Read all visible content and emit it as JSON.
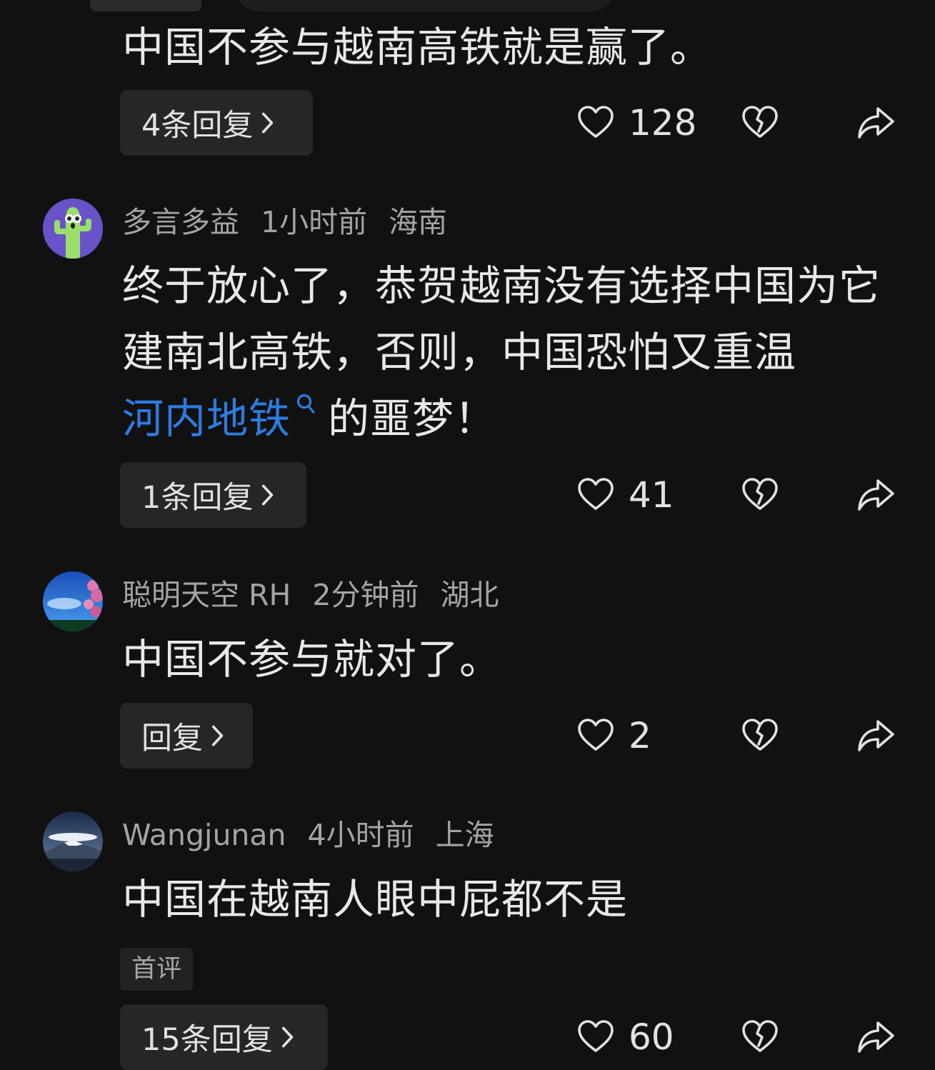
{
  "partial_top": {
    "text": "中国不参与越南高铁就是赢了。",
    "reply_label": "4条回复",
    "likes": "128"
  },
  "comments": [
    {
      "username": "多言多益",
      "time": "1小时前",
      "location": "海南",
      "text_before_link": "终于放心了，恭贺越南没有选择中国为它建南北高铁，否则，中国恐怕又重温",
      "link_text": "河内地铁",
      "text_after_link": "的噩梦！",
      "reply_label": "1条回复",
      "likes": "41",
      "avatar_icon": "cactus-avatar-icon"
    },
    {
      "username": "聪明天空 RH",
      "time": "2分钟前",
      "location": "湖北",
      "text": "中国不参与就对了。",
      "reply_label": "回复",
      "likes": "2",
      "avatar_icon": "sky-flowers-avatar-icon"
    },
    {
      "username": "Wangjunan",
      "time": "4小时前",
      "location": "上海",
      "text": "中国在越南人眼中屁都不是",
      "tag": "首评",
      "reply_label": "15条回复",
      "likes": "60",
      "avatar_icon": "mountain-avatar-icon"
    }
  ],
  "colors": {
    "background": "#111112",
    "link": "#2d7ce0",
    "meta_text": "#a4a4a6",
    "button_bg": "#262628"
  }
}
